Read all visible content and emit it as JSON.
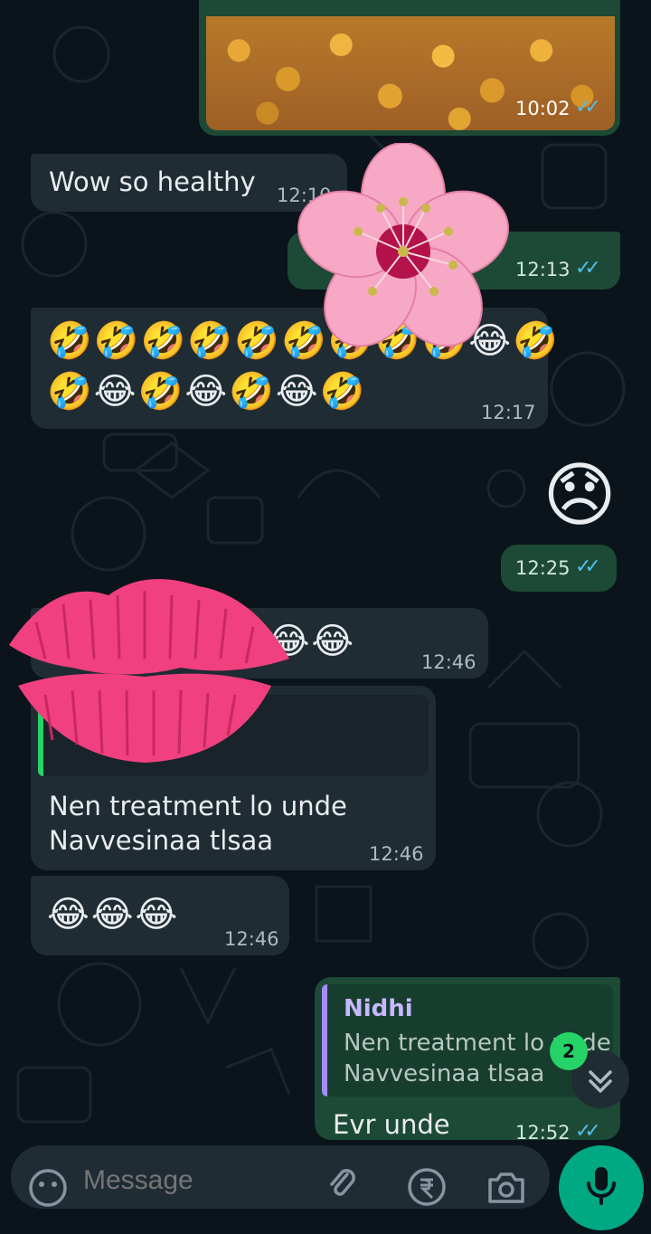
{
  "messages": {
    "image_time": "10:02",
    "m1_text": "Wow so healthy",
    "m1_time": "12:10",
    "m2_time": "12:13",
    "m3_row1": "🤣🤣🤣🤣🤣🤣🤣🤣🤣😂🤣",
    "m3_row2": "🤣😂🤣😂🤣😂🤣",
    "m3_time": "12:17",
    "m4_sticker": "😞",
    "m4_time": "12:25",
    "m5_emoji": "😂😂😂😂😂😂😂",
    "m5_time": "12:46",
    "m6_line1": "Nen treatment lo unde",
    "m6_line2": "Navvesinaa tlsaa",
    "m6_time": "12:46",
    "m7_emoji": "😂😂😂",
    "m7_time": "12:46",
    "m8_reply_name": "Nidhi",
    "m8_reply_line1": "Nen treatment lo unde",
    "m8_reply_line2": "Navvesinaa tlsaa",
    "m8_text": "Evr unde",
    "m8_time": "12:52"
  },
  "composer": {
    "placeholder": "Message"
  },
  "scroll": {
    "unread_count": "2"
  },
  "icons": {
    "read": "double-check-icon",
    "emoji": "emoji-icon",
    "attach": "paperclip-icon",
    "rupee": "rupee-icon",
    "camera": "camera-icon",
    "mic": "microphone-icon",
    "scroll": "chevron-double-down-icon"
  },
  "colors": {
    "background": "#0b141a",
    "incoming": "#202c33",
    "outgoing": "#1c4a36",
    "read_ticks": "#53bdeb",
    "accent": "#00a884",
    "badge": "#25d366"
  }
}
